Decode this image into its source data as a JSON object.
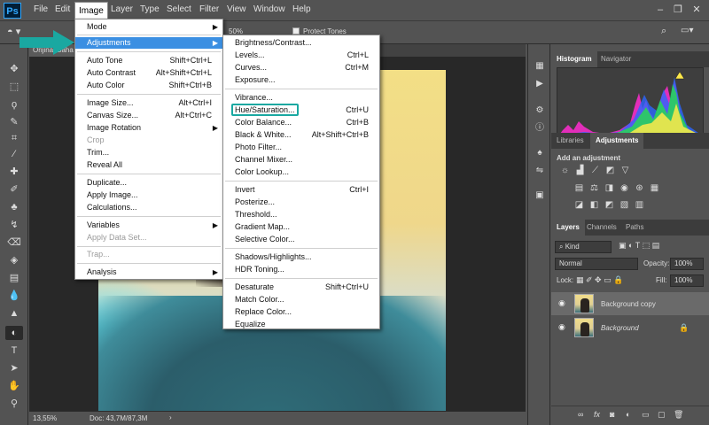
{
  "app": {
    "logo": "Ps",
    "menus": [
      "File",
      "Edit",
      "Image",
      "Layer",
      "Type",
      "Select",
      "Filter",
      "View",
      "Window",
      "Help"
    ],
    "active_menu": "Image"
  },
  "window_controls": [
    "–",
    "❐",
    "✕"
  ],
  "options_bar": {
    "zoom": "50%",
    "protect_tones": "Protect Tones",
    "title_fragment": "Orijinal Baha"
  },
  "status": {
    "zoom": "13,55%",
    "doc": "Doc: 43,7M/87,3M"
  },
  "image_menu": [
    {
      "label": "Mode",
      "arrow": true
    },
    {
      "label": "Adjustments",
      "arrow": true,
      "highlight": true
    },
    {
      "label": "Auto Tone",
      "shortcut": "Shift+Ctrl+L"
    },
    {
      "label": "Auto Contrast",
      "shortcut": "Alt+Shift+Ctrl+L"
    },
    {
      "label": "Auto Color",
      "shortcut": "Shift+Ctrl+B"
    },
    {
      "label": "Image Size...",
      "shortcut": "Alt+Ctrl+I"
    },
    {
      "label": "Canvas Size...",
      "shortcut": "Alt+Ctrl+C"
    },
    {
      "label": "Image Rotation",
      "arrow": true
    },
    {
      "label": "Crop",
      "disabled": true
    },
    {
      "label": "Trim..."
    },
    {
      "label": "Reveal All"
    },
    {
      "label": "Duplicate..."
    },
    {
      "label": "Apply Image..."
    },
    {
      "label": "Calculations..."
    },
    {
      "label": "Variables",
      "arrow": true
    },
    {
      "label": "Apply Data Set...",
      "disabled": true
    },
    {
      "label": "Trap...",
      "disabled": true
    },
    {
      "label": "Analysis",
      "arrow": true
    }
  ],
  "adjustments_menu": [
    {
      "label": "Brightness/Contrast..."
    },
    {
      "label": "Levels...",
      "shortcut": "Ctrl+L"
    },
    {
      "label": "Curves...",
      "shortcut": "Ctrl+M"
    },
    {
      "label": "Exposure..."
    },
    {
      "label": "Vibrance..."
    },
    {
      "label": "Hue/Saturation...",
      "shortcut": "Ctrl+U",
      "boxed": true
    },
    {
      "label": "Color Balance...",
      "shortcut": "Ctrl+B"
    },
    {
      "label": "Black & White...",
      "shortcut": "Alt+Shift+Ctrl+B"
    },
    {
      "label": "Photo Filter..."
    },
    {
      "label": "Channel Mixer..."
    },
    {
      "label": "Color Lookup..."
    },
    {
      "label": "Invert",
      "shortcut": "Ctrl+I"
    },
    {
      "label": "Posterize..."
    },
    {
      "label": "Threshold..."
    },
    {
      "label": "Gradient Map..."
    },
    {
      "label": "Selective Color..."
    },
    {
      "label": "Shadows/Highlights..."
    },
    {
      "label": "HDR Toning..."
    },
    {
      "label": "Desaturate",
      "shortcut": "Shift+Ctrl+U"
    },
    {
      "label": "Match Color..."
    },
    {
      "label": "Replace Color..."
    },
    {
      "label": "Equalize"
    }
  ],
  "panels": {
    "histogram_tabs": [
      "Histogram",
      "Navigator"
    ],
    "adjust_tabs": [
      "Libraries",
      "Adjustments"
    ],
    "add_adjustment": "Add an adjustment",
    "layer_tabs": [
      "Layers",
      "Channels",
      "Paths"
    ],
    "filter_kind": "Kind",
    "blend_mode": "Normal",
    "opacity_label": "Opacity:",
    "opacity_value": "100%",
    "lock_label": "Lock:",
    "fill_label": "Fill:",
    "fill_value": "100%",
    "layers": [
      {
        "name": "Background copy",
        "selected": true
      },
      {
        "name": "Background",
        "locked": true
      }
    ],
    "footer_icons": [
      "fx"
    ]
  },
  "colors": {
    "menu_highlight": "#3b8fe2",
    "callout": "#1aa8a1"
  }
}
